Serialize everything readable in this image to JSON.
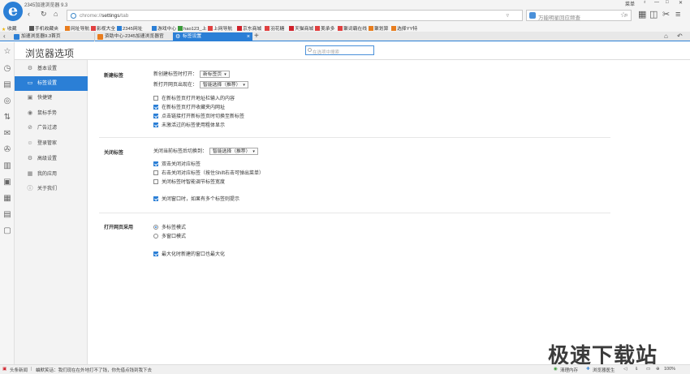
{
  "window": {
    "title": "2345加速浏览器 9.3",
    "controls": [
      "菜单",
      "—",
      "□",
      "✕"
    ]
  },
  "nav": {
    "url_prefix": "chrome://",
    "url_main": "settings",
    "url_suffix": "/tab",
    "search_placeholder": "万能明星回应频查"
  },
  "bookmarks": [
    {
      "label": "收藏",
      "color": "#f0b400"
    },
    {
      "label": "手机收藏夹",
      "color": "#555555"
    },
    {
      "label": "网址导航",
      "color": "#e87d1e"
    },
    {
      "label": "影视大全",
      "color": "#e04040"
    },
    {
      "label": "2345网址",
      "color": "#2b7fd6"
    },
    {
      "label": "游戏中心",
      "color": "#2b7fd6"
    },
    {
      "label": "hao123_上",
      "color": "#3a9a3a"
    },
    {
      "label": "上网导航",
      "color": "#e04040"
    },
    {
      "label": "京东商城",
      "color": "#d0202a"
    },
    {
      "label": "羽花糖",
      "color": "#e04040"
    },
    {
      "label": "天猫商城",
      "color": "#d0202a"
    },
    {
      "label": "美承多",
      "color": "#e04040"
    },
    {
      "label": "聚词霸在线",
      "color": "#e04040"
    },
    {
      "label": "聚划算",
      "color": "#e87d1e"
    },
    {
      "label": "选择YY特",
      "color": "#e87d1e"
    }
  ],
  "tabs": [
    {
      "label": "加速浏览器9.3首页",
      "active": false,
      "color": "#2b7fd6"
    },
    {
      "label": "资助中心-2345加速浏览器官",
      "active": false,
      "color": "#e87d1e"
    },
    {
      "label": "标签设置",
      "active": true,
      "color": "#ffffff"
    }
  ],
  "page": {
    "title": "浏览器选项",
    "search_placeholder": "在选项中搜索"
  },
  "sidebar": [
    {
      "label": "基本设置",
      "icon": "gear-icon",
      "glyph": "⚙",
      "active": false
    },
    {
      "label": "标签设置",
      "icon": "tab-icon",
      "glyph": "▭",
      "active": true
    },
    {
      "label": "快捷键",
      "icon": "keyboard-icon",
      "glyph": "▣",
      "active": false
    },
    {
      "label": "鼠标手势",
      "icon": "mouse-icon",
      "glyph": "◉",
      "active": false
    },
    {
      "label": "广告过滤",
      "icon": "block-icon",
      "glyph": "⊘",
      "active": false
    },
    {
      "label": "登录管家",
      "icon": "user-icon",
      "glyph": "☺",
      "active": false
    },
    {
      "label": "高级设置",
      "icon": "advanced-gear-icon",
      "glyph": "⚙",
      "active": false
    },
    {
      "label": "我的应用",
      "icon": "apps-icon",
      "glyph": "▦",
      "active": false
    },
    {
      "label": "关于我们",
      "icon": "info-icon",
      "glyph": "ⓘ",
      "active": false
    }
  ],
  "new_tab": {
    "section_label": "新建标签",
    "new_tab_open_label": "新创建标签时打开：",
    "new_tab_open_value": "新标签页",
    "new_tab_position_label": "新打开网页出现在：",
    "new_tab_position_value": "智能选择（推荐）",
    "options": [
      {
        "label": "在新标签页打开地址栏输入的内容",
        "checked": false
      },
      {
        "label": "在新标签页打开收藏夹内网址",
        "checked": true
      },
      {
        "label": "点击链接打开新标签页时切换至新标签",
        "checked": true
      },
      {
        "label": "未激活过的标签使用粗体显示",
        "checked": true
      }
    ]
  },
  "close_tab": {
    "section_label": "关闭标签",
    "switch_label": "关闭当前标签后切换到：",
    "switch_value": "智能选择（推荐）",
    "options": [
      {
        "label": "双击关闭对应标签",
        "checked": true
      },
      {
        "label": "右击关闭对应标签（按住Shift右击可弹出菜单）",
        "checked": false
      },
      {
        "label": "关闭标签时智能调节标签宽度",
        "checked": false
      }
    ],
    "window_option": {
      "label": "关闭窗口时，如果有多个标签则提示",
      "checked": true
    }
  },
  "open_pages": {
    "section_label": "打开网页采用",
    "radios": [
      {
        "label": "多标签模式",
        "selected": true
      },
      {
        "label": "多窗口模式",
        "selected": false
      }
    ],
    "maximize_option": {
      "label": "最大化时新建的窗口也最大化",
      "checked": true
    }
  },
  "status": {
    "news": "头条新闻",
    "ticker": "蛐默笑话：我们现在在外地打不了钱，你先借点钱到我下去",
    "memory": "清理内存",
    "doctor": "浏览器医生",
    "zoom": "100%"
  },
  "watermark": "极速下载站"
}
